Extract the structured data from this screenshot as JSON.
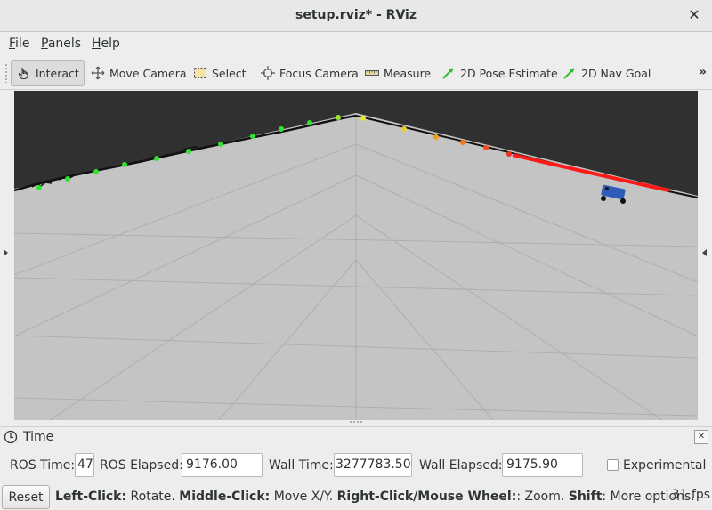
{
  "window": {
    "title": "setup.rviz* - RViz",
    "close_glyph": "✕"
  },
  "menu": {
    "items": [
      "File",
      "Panels",
      "Help"
    ]
  },
  "toolbar": {
    "tools": [
      {
        "label": "Interact",
        "icon": "hand-pointer-icon",
        "active": true
      },
      {
        "label": "Move Camera",
        "icon": "move-arrows-icon"
      },
      {
        "label": "Select",
        "icon": "select-rect-icon"
      },
      {
        "label": "Focus Camera",
        "icon": "focus-crosshair-icon"
      },
      {
        "label": "Measure",
        "icon": "ruler-icon"
      },
      {
        "label": "2D Pose Estimate",
        "icon": "green-arrow-icon"
      },
      {
        "label": "2D Nav Goal",
        "icon": "green-arrow-icon"
      }
    ],
    "overflow_glyph": "»"
  },
  "colors": {
    "sky": "#303030",
    "ground": "#c4c4c4",
    "grid": "#a8a8a8",
    "path": "#ff1a1a",
    "robot": "#2e5cb8",
    "points_green": "#2ee62e"
  },
  "time_panel": {
    "title": "Time",
    "close_glyph": "✕",
    "ros_time_label": "ROS Time:",
    "ros_time_value": "47",
    "ros_elapsed_label": "ROS Elapsed:",
    "ros_elapsed_value": "9176.00",
    "wall_time_label": "Wall Time:",
    "wall_time_value": "3277783.50",
    "wall_elapsed_label": "Wall Elapsed:",
    "wall_elapsed_value": "9175.90",
    "experimental_label": "Experimental",
    "experimental_checked": false
  },
  "status": {
    "reset_label": "Reset",
    "hint_parts": [
      {
        "text": "Left-Click:",
        "bold": true
      },
      {
        "text": " Rotate. ",
        "bold": false
      },
      {
        "text": "Middle-Click:",
        "bold": true
      },
      {
        "text": " Move X/Y. ",
        "bold": false
      },
      {
        "text": "Right-Click/Mouse Wheel:",
        "bold": true
      },
      {
        "text": ": Zoom. ",
        "bold": false
      },
      {
        "text": "Shift",
        "bold": true
      },
      {
        "text": ": More options.",
        "bold": false
      }
    ],
    "fps": "31 fps"
  }
}
